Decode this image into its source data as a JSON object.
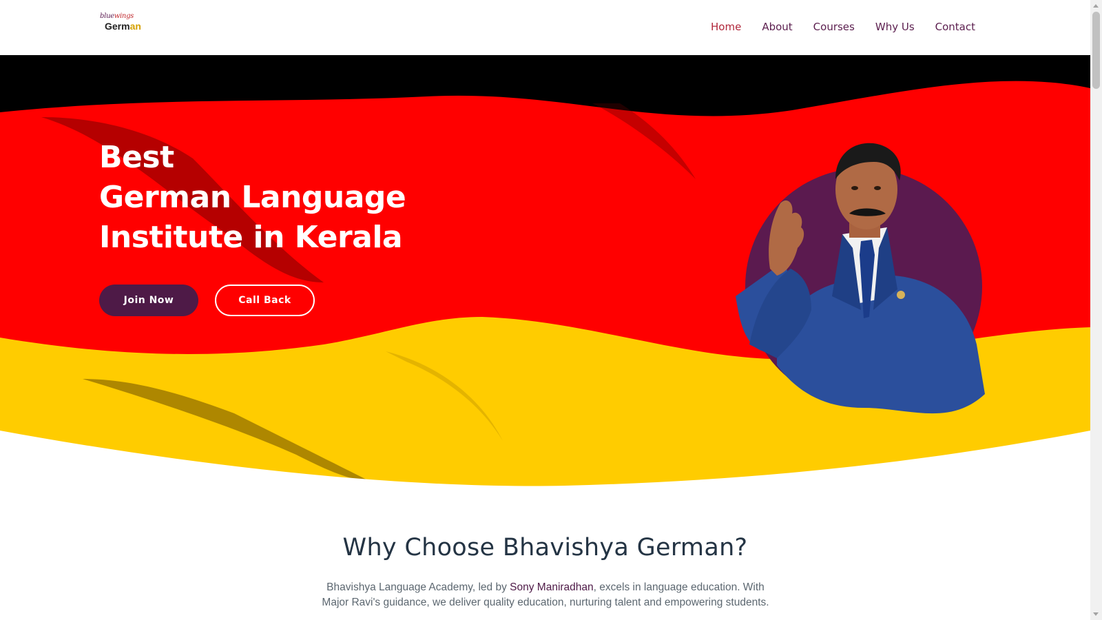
{
  "header": {
    "logo": {
      "line1_prefix": "blue",
      "line1_accent": "wings",
      "line2_main": "Germ",
      "line2_accent": "an"
    },
    "nav": [
      {
        "label": "Home",
        "active": true
      },
      {
        "label": "About",
        "active": false
      },
      {
        "label": "Courses",
        "active": false
      },
      {
        "label": "Why Us",
        "active": false
      },
      {
        "label": "Contact",
        "active": false
      }
    ]
  },
  "hero": {
    "title_lines": [
      "Best",
      "German Language",
      "Institute in Kerala"
    ],
    "join_label": "Join Now",
    "call_label": "Call Back",
    "colors": {
      "black": "#000000",
      "red": "#ff0000",
      "gold": "#ffcc00",
      "purple": "#5b1a4f"
    }
  },
  "section": {
    "title": "Why Choose Bhavishya German?",
    "text_before": "Bhavishya Language Academy, led by ",
    "text_person": "Sony Maniradhan",
    "text_after": ", excels in language education. With Major Ravi's guidance, we deliver quality education, nurturing talent and empowering students."
  }
}
